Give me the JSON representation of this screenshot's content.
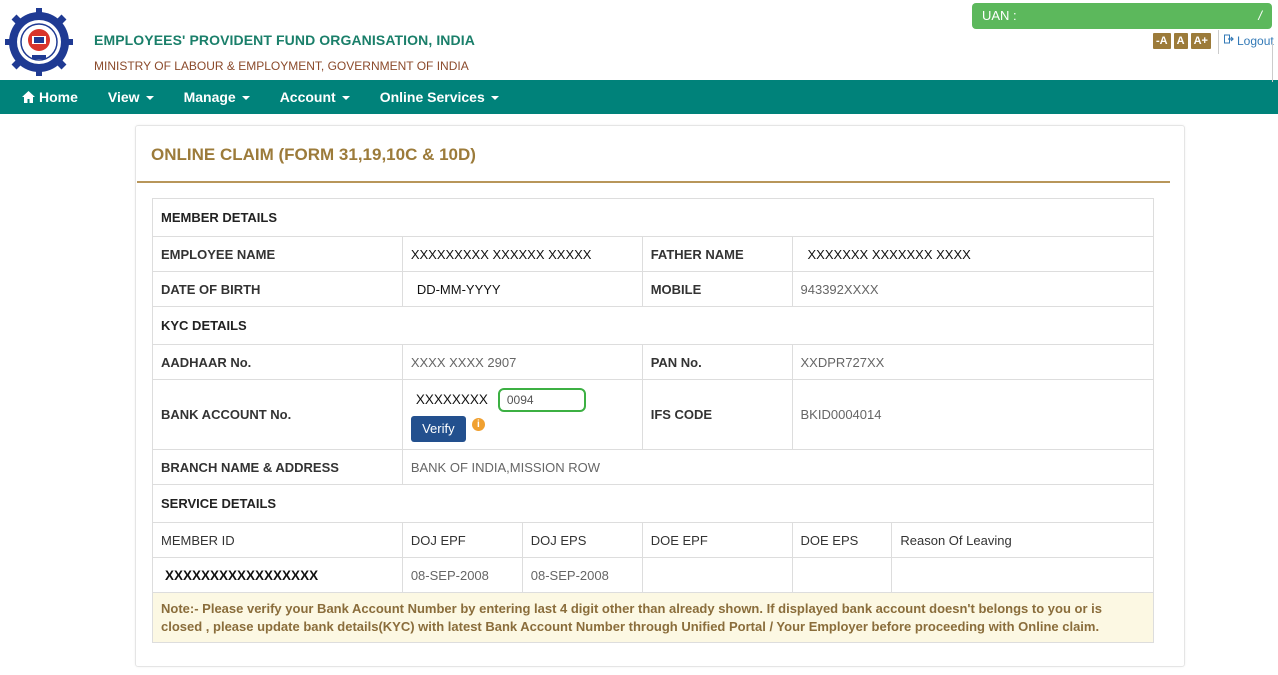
{
  "header": {
    "org_name": "EMPLOYEES' PROVIDENT FUND ORGANISATION, INDIA",
    "ministry": "MINISTRY OF LABOUR & EMPLOYMENT, GOVERNMENT OF INDIA",
    "uan_label": "UAN :",
    "uan_end": "/",
    "font_small": "-A",
    "font_normal": "A",
    "font_large": "A+",
    "logout": "Logout"
  },
  "nav": {
    "home": "Home",
    "view": "View",
    "manage": "Manage",
    "account": "Account",
    "online_services": "Online Services"
  },
  "panel": {
    "title": "ONLINE CLAIM (FORM 31,19,10C & 10D)"
  },
  "member": {
    "section": "MEMBER DETAILS",
    "employee_name_label": "EMPLOYEE NAME",
    "employee_name": "XXXXXXXXX XXXXXX XXXXX",
    "father_name_label": "FATHER NAME",
    "father_name": "XXXXXXX XXXXXXX XXXX",
    "dob_label": "DATE OF BIRTH",
    "dob": "DD-MM-YYYY",
    "mobile_label": "MOBILE",
    "mobile": "943392XXXX"
  },
  "kyc": {
    "section": "KYC DETAILS",
    "aadhaar_label": "AADHAAR No.",
    "aadhaar": "XXXX XXXX 2907",
    "pan_label": "PAN No.",
    "pan": "XXDPR727XX",
    "bank_label": "BANK ACCOUNT No.",
    "bank_mask": "XXXXXXXX",
    "bank_input_value": "0094",
    "verify": "Verify",
    "info": "i",
    "ifsc_label": "IFS CODE",
    "ifsc": "BKID0004014",
    "branch_label": "BRANCH NAME & ADDRESS",
    "branch": "BANK OF INDIA,MISSION ROW"
  },
  "service": {
    "section": "SERVICE DETAILS",
    "headers": [
      "MEMBER ID",
      "DOJ EPF",
      "DOJ EPS",
      "DOE EPF",
      "DOE EPS",
      "Reason Of Leaving"
    ],
    "row": [
      "XXXXXXXXXXXXXXXXX",
      "08-SEP-2008",
      "08-SEP-2008",
      "",
      "",
      ""
    ]
  },
  "note": "Note:- Please verify your Bank Account Number by entering last 4 digit other than already shown. If displayed bank account doesn't belongs to you or is closed , please update bank details(KYC) with latest Bank Account Number through Unified Portal / Your Employer before proceeding with Online claim."
}
